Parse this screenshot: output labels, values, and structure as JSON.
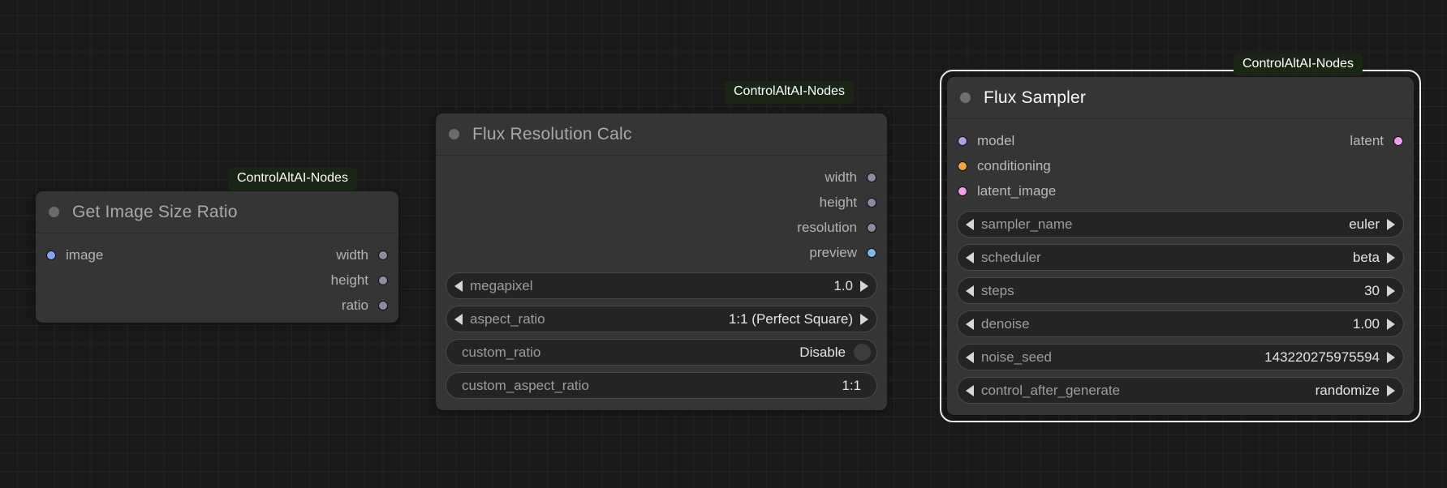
{
  "canvas": {
    "background_color": "#191919",
    "grid_minor_color": "#242424",
    "grid_major_color": "#2e2e2e"
  },
  "colors": {
    "node_body": "#353535",
    "widget_fill": "#242424",
    "widget_border": "#4a4a4a",
    "badge_background": "#1b2516",
    "badge_text": "#ffffff",
    "selection_outline": "#e9e9e9",
    "port_image_blue": "#7fa6ef",
    "port_int_gray": "#8c8c9f",
    "port_preview_blue": "#7fb6f2",
    "port_model_purple": "#b49ce4",
    "port_conditioning_orange": "#f0a73c",
    "port_latent_pink": "#ee9fe8"
  },
  "badges": [
    {
      "id": "badge-get-image-size-ratio",
      "label": "ControlAltAI-Nodes"
    },
    {
      "id": "badge-flux-resolution-calc",
      "label": "ControlAltAI-Nodes"
    },
    {
      "id": "badge-flux-sampler",
      "label": "ControlAltAI-Nodes"
    }
  ],
  "nodes": [
    {
      "id": "get-image-size-ratio",
      "title": "Get Image Size Ratio",
      "selected": false,
      "inputs": [
        {
          "label": "image",
          "color": "#7fa6ef"
        }
      ],
      "outputs": [
        {
          "label": "width",
          "color": "#8c8c9f"
        },
        {
          "label": "height",
          "color": "#8c8c9f"
        },
        {
          "label": "ratio",
          "color": "#8c8c9f"
        }
      ],
      "widgets": []
    },
    {
      "id": "flux-resolution-calc",
      "title": "Flux Resolution Calc",
      "selected": false,
      "inputs": [],
      "outputs": [
        {
          "label": "width",
          "color": "#8c8c9f"
        },
        {
          "label": "height",
          "color": "#8c8c9f"
        },
        {
          "label": "resolution",
          "color": "#8c8c9f"
        },
        {
          "label": "preview",
          "color": "#7fb6f2"
        }
      ],
      "widgets": [
        {
          "name": "megapixel",
          "value": "1.0",
          "type": "stepper"
        },
        {
          "name": "aspect_ratio",
          "value": "1:1 (Perfect Square)",
          "type": "stepper"
        },
        {
          "name": "custom_ratio",
          "value": "Disable",
          "type": "toggle"
        },
        {
          "name": "custom_aspect_ratio",
          "value": "1:1",
          "type": "text"
        }
      ]
    },
    {
      "id": "flux-sampler",
      "title": "Flux Sampler",
      "selected": true,
      "inputs": [
        {
          "label": "model",
          "color": "#b49ce4"
        },
        {
          "label": "conditioning",
          "color": "#f0a73c"
        },
        {
          "label": "latent_image",
          "color": "#ee9fe8"
        }
      ],
      "outputs": [
        {
          "label": "latent",
          "color": "#ee9fe8"
        }
      ],
      "widgets": [
        {
          "name": "sampler_name",
          "value": "euler",
          "type": "stepper"
        },
        {
          "name": "scheduler",
          "value": "beta",
          "type": "stepper"
        },
        {
          "name": "steps",
          "value": "30",
          "type": "stepper"
        },
        {
          "name": "denoise",
          "value": "1.00",
          "type": "stepper"
        },
        {
          "name": "noise_seed",
          "value": "143220275975594",
          "type": "stepper"
        },
        {
          "name": "control_after_generate",
          "value": "randomize",
          "type": "stepper"
        }
      ]
    }
  ]
}
